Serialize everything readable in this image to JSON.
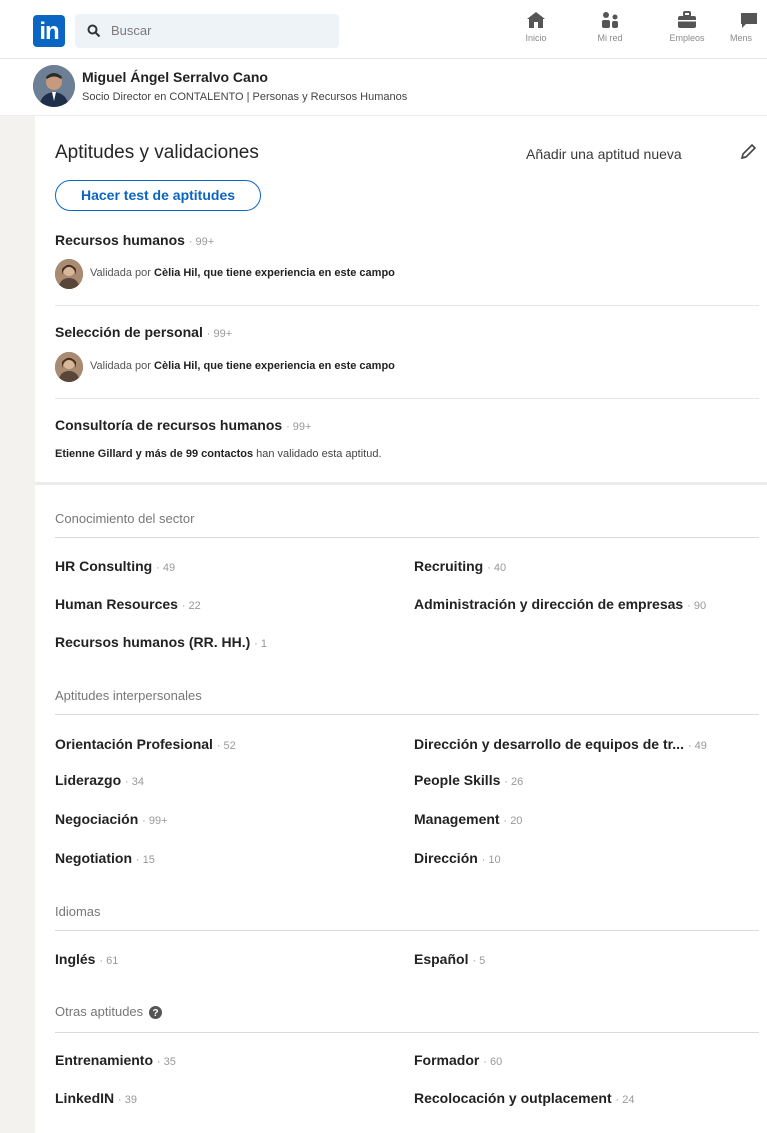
{
  "topbar": {
    "logo_text": "in",
    "search_placeholder": "Buscar",
    "nav": [
      {
        "label": "Inicio",
        "icon": "home-icon"
      },
      {
        "label": "Mi red",
        "icon": "network-icon"
      },
      {
        "label": "Empleos",
        "icon": "briefcase-icon"
      },
      {
        "label": "Mens",
        "icon": "messaging-icon"
      }
    ]
  },
  "profile": {
    "name": "Miguel Ángel Serralvo Cano",
    "headline": "Socio Director en CONTALENTO | Personas y Recursos Humanos"
  },
  "section": {
    "title": "Aptitudes y validaciones",
    "add_skill": "Añadir una aptitud nueva",
    "test_button": "Hacer test de aptitudes"
  },
  "top_skills": [
    {
      "name": "Recursos humanos",
      "count": "· 99+",
      "endorse_prefix": "Validada por ",
      "endorse_bold": "Cèlia Hil, que tiene experiencia en este campo"
    },
    {
      "name": "Selección de personal",
      "count": "· 99+",
      "endorse_prefix": "Validada por ",
      "endorse_bold": "Cèlia Hil, que tiene experiencia en este campo"
    },
    {
      "name": "Consultoría de recursos humanos",
      "count": "· 99+",
      "endorse_bold": "Etienne Gillard y más de 99 contactos",
      "endorse_suffix": " han validado esta aptitud."
    }
  ],
  "categories": [
    {
      "header": "Conocimiento del sector",
      "skills": [
        {
          "name": "HR Consulting",
          "count": "· 49"
        },
        {
          "name": "Recruiting",
          "count": "· 40"
        },
        {
          "name": "Human Resources",
          "count": "· 22"
        },
        {
          "name": "Administración y dirección de empresas",
          "count": "· 90"
        },
        {
          "name": "Recursos humanos (RR. HH.)",
          "count": "· 1"
        }
      ]
    },
    {
      "header": "Aptitudes interpersonales",
      "skills": [
        {
          "name": "Orientación Profesional",
          "count": "· 52"
        },
        {
          "name": "Dirección y desarrollo de equipos de tr...",
          "count": "· 49"
        },
        {
          "name": "Liderazgo",
          "count": "· 34"
        },
        {
          "name": "People Skills",
          "count": "· 26"
        },
        {
          "name": "Negociación",
          "count": "· 99+"
        },
        {
          "name": "Management",
          "count": "· 20"
        },
        {
          "name": "Negotiation",
          "count": "· 15"
        },
        {
          "name": "Dirección",
          "count": "· 10"
        }
      ]
    },
    {
      "header": "Idiomas",
      "skills": [
        {
          "name": "Inglés",
          "count": "· 61"
        },
        {
          "name": "Español",
          "count": "· 5"
        }
      ]
    },
    {
      "header": "Otras aptitudes",
      "skills": [
        {
          "name": "Entrenamiento",
          "count": "· 35"
        },
        {
          "name": "Formador",
          "count": "· 60"
        },
        {
          "name": "LinkedIN",
          "count": "· 39"
        },
        {
          "name": "Recolocación y outplacement",
          "count": "· 24"
        }
      ]
    }
  ],
  "colors": {
    "brand": "#0a66c2",
    "background": "#f3f2ef"
  }
}
